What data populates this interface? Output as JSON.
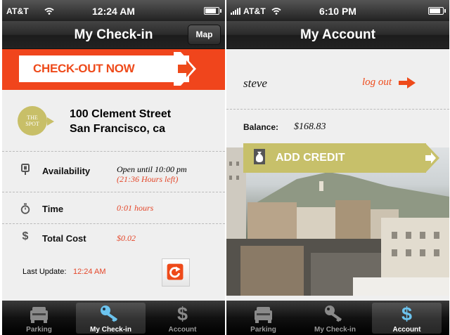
{
  "left": {
    "status": {
      "carrier": "AT&T",
      "time": "12:24 AM",
      "battery_level": 0.8
    },
    "nav": {
      "title": "My Check-in",
      "map_button": "Map"
    },
    "checkout": {
      "label": "CHECK-OUT NOW"
    },
    "spot": {
      "badge_line1": "THE",
      "badge_line2": "SPOT",
      "address_line1": "100 Clement Street",
      "address_line2": "San Francisco, ca"
    },
    "availability": {
      "label": "Availability",
      "value": "Open until  10:00 pm",
      "remaining": "(21:36 Hours left)",
      "icon": "parking-meter-icon"
    },
    "time": {
      "label": "Time",
      "value": "0:01 hours",
      "icon": "stopwatch-icon"
    },
    "cost": {
      "label": "Total Cost",
      "value": "$0.02",
      "icon": "dollar-icon"
    },
    "update": {
      "label": "Last Update:",
      "value": "12:24 AM"
    },
    "tabs": [
      {
        "label": "Parking",
        "icon": "car-icon"
      },
      {
        "label": "My Check-in",
        "icon": "key-icon",
        "active": true
      },
      {
        "label": "Account",
        "icon": "dollar-icon"
      }
    ]
  },
  "right": {
    "status": {
      "carrier": "AT&T",
      "time": "6:10 PM",
      "battery_level": 0.8
    },
    "nav": {
      "title": "My Account"
    },
    "account": {
      "username": "steve",
      "logout": "log out"
    },
    "balance": {
      "label": "Balance:",
      "value": "$168.83"
    },
    "add_credit": {
      "label": "ADD CREDIT"
    },
    "tabs": [
      {
        "label": "Parking",
        "icon": "car-icon"
      },
      {
        "label": "My Check-in",
        "icon": "key-icon"
      },
      {
        "label": "Account",
        "icon": "dollar-icon",
        "active": true
      }
    ]
  },
  "colors": {
    "accent": "#ee4a1a",
    "olive": "#c7c06a",
    "key_blue": "#6cc4ef"
  }
}
